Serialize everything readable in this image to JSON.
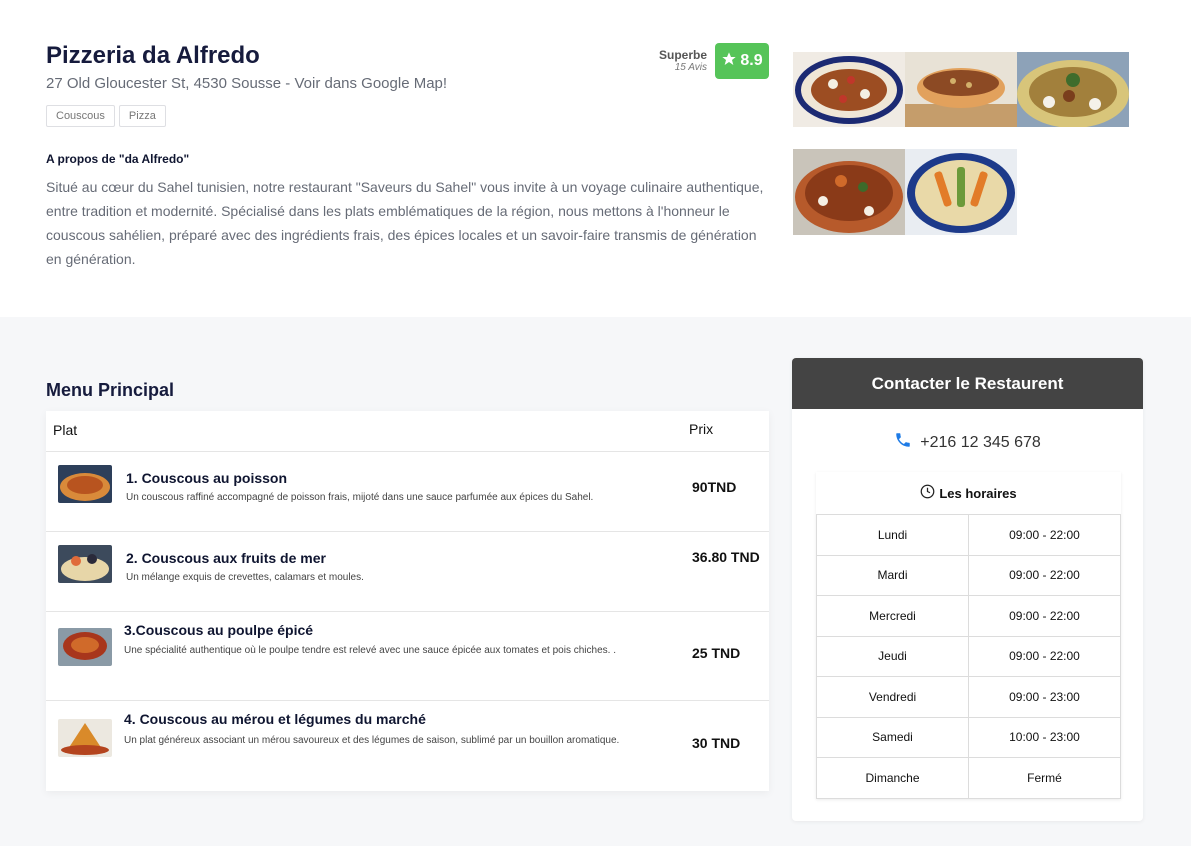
{
  "restaurant": {
    "name": "Pizzeria da Alfredo",
    "address": "27 Old Gloucester St, 4530 Sousse - Voir dans Google Map!",
    "tags": [
      "Couscous",
      "Pizza"
    ],
    "rating_label": "Superbe",
    "rating_count": "15 Avis",
    "rating_score": "8.9",
    "about_title": "A propos de \"da Alfredo\"",
    "about_text": "Situé au cœur du Sahel tunisien, notre restaurant \"Saveurs du Sahel\" vous invite à un voyage culinaire authentique, entre tradition et modernité. Spécialisé dans les plats emblématiques de la région, nous mettons à l'honneur le couscous sahélien, préparé avec des ingrédients frais, des épices locales et un savoir-faire transmis de génération en génération."
  },
  "gallery_icons": [
    "photo-couscous-1",
    "photo-couscous-2",
    "photo-couscous-3",
    "photo-couscous-4",
    "photo-couscous-5"
  ],
  "menu": {
    "title": "Menu Principal",
    "col_plat": "Plat",
    "col_prix": "Prix",
    "items": [
      {
        "name": "1. Couscous au poisson",
        "desc": "Un couscous raffiné accompagné de poisson frais, mijoté dans une sauce parfumée aux épices du Sahel.",
        "price": "90TND"
      },
      {
        "name": "2. Couscous aux fruits de mer",
        "desc": "Un mélange exquis de crevettes, calamars et moules.",
        "price": "36.80 TND"
      },
      {
        "name": "3.Couscous au poulpe épicé",
        "desc": "Une spécialité authentique où le poulpe tendre est relevé avec une sauce épicée aux tomates et pois chiches. .",
        "price": "25 TND"
      },
      {
        "name": "4. Couscous au mérou et légumes du marché",
        "desc": "Un plat généreux associant un mérou savoureux et des légumes de saison, sublimé par un bouillon aromatique.",
        "price": "30 TND"
      }
    ]
  },
  "contact": {
    "title": "Contacter le Restaurent",
    "phone": "+216 12 345 678",
    "hours_title": "Les horaires",
    "hours": [
      {
        "day": "Lundi",
        "time": "09:00 - 22:00"
      },
      {
        "day": "Mardi",
        "time": "09:00 - 22:00"
      },
      {
        "day": "Mercredi",
        "time": "09:00 - 22:00"
      },
      {
        "day": "Jeudi",
        "time": "09:00 - 22:00"
      },
      {
        "day": "Vendredi",
        "time": "09:00 - 23:00"
      },
      {
        "day": "Samedi",
        "time": "10:00 - 23:00"
      },
      {
        "day": "Dimanche",
        "time": "Fermé"
      }
    ]
  },
  "colors": {
    "rating_green": "#56c459",
    "contact_header": "#444444",
    "phone_blue": "#1e7be6"
  }
}
